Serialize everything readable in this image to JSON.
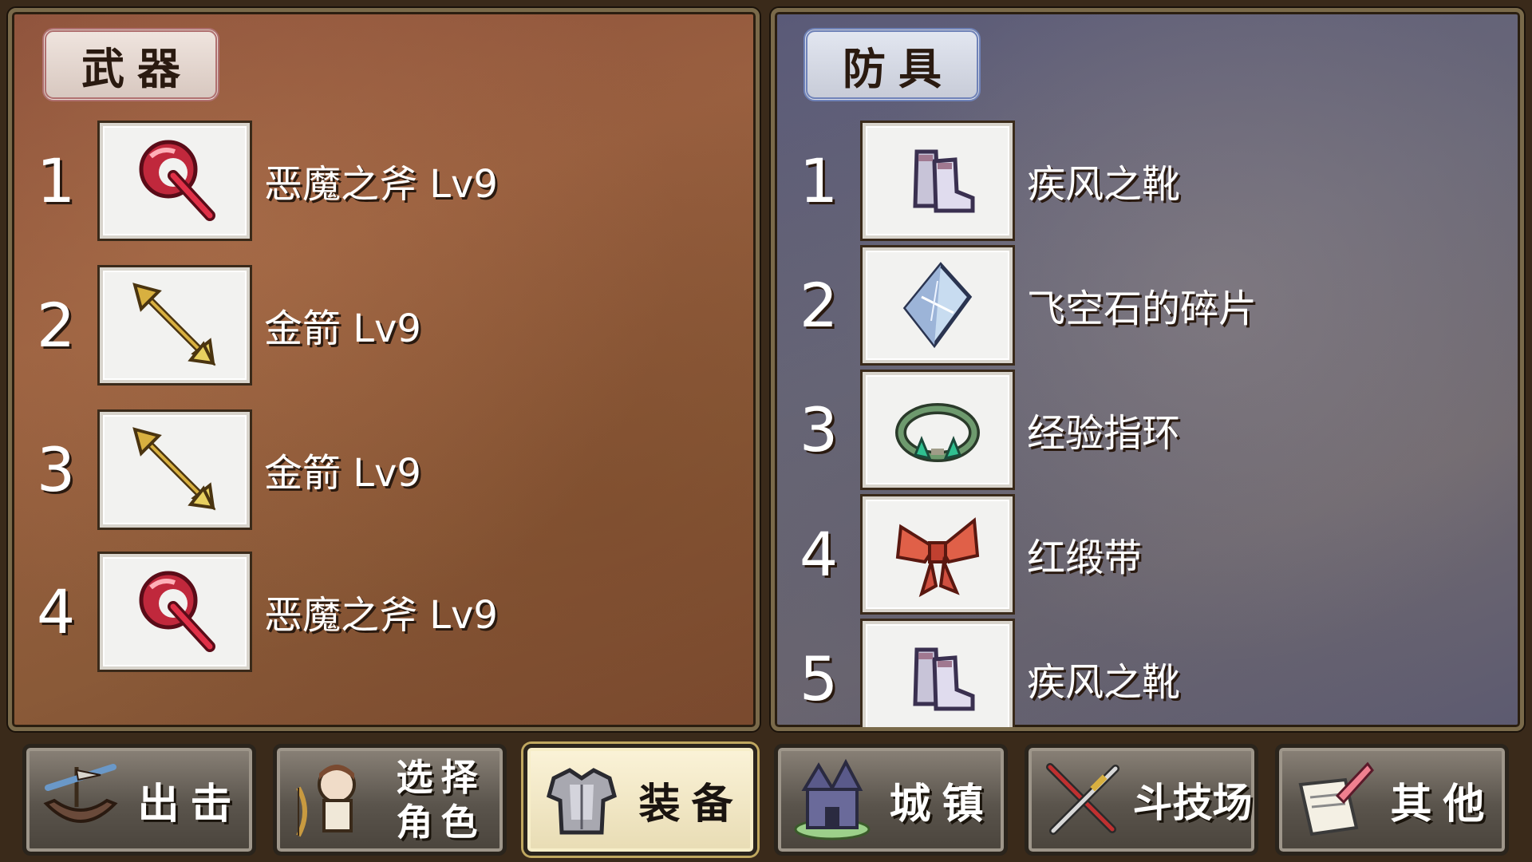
{
  "weapon_panel": {
    "title": "武器",
    "slots": [
      {
        "num": "1",
        "name": "恶魔之斧 Lv9",
        "icon": "axe-icon"
      },
      {
        "num": "2",
        "name": "金箭 Lv9",
        "icon": "arrow-icon"
      },
      {
        "num": "3",
        "name": "金箭 Lv9",
        "icon": "arrow-icon"
      },
      {
        "num": "4",
        "name": "恶魔之斧 Lv9",
        "icon": "axe-icon"
      }
    ]
  },
  "armor_panel": {
    "title": "防具",
    "slots": [
      {
        "num": "1",
        "name": "疾风之靴",
        "icon": "boots-icon"
      },
      {
        "num": "2",
        "name": "飞空石的碎片",
        "icon": "crystal-icon"
      },
      {
        "num": "3",
        "name": "经验指环",
        "icon": "ring-icon"
      },
      {
        "num": "4",
        "name": "红缎带",
        "icon": "ribbon-icon"
      },
      {
        "num": "5",
        "name": "疾风之靴",
        "icon": "boots-icon"
      }
    ]
  },
  "navbar": {
    "sortie": "出击",
    "select_char_line1": "选择",
    "select_char_line2": "角色",
    "equip": "装备",
    "town": "城镇",
    "arena": "斗技场",
    "other": "其他",
    "active": "equip"
  },
  "colors": {
    "weapon_accent": "#b07070",
    "armor_accent": "#6f82b8",
    "active_button": "#fbf3d8"
  }
}
